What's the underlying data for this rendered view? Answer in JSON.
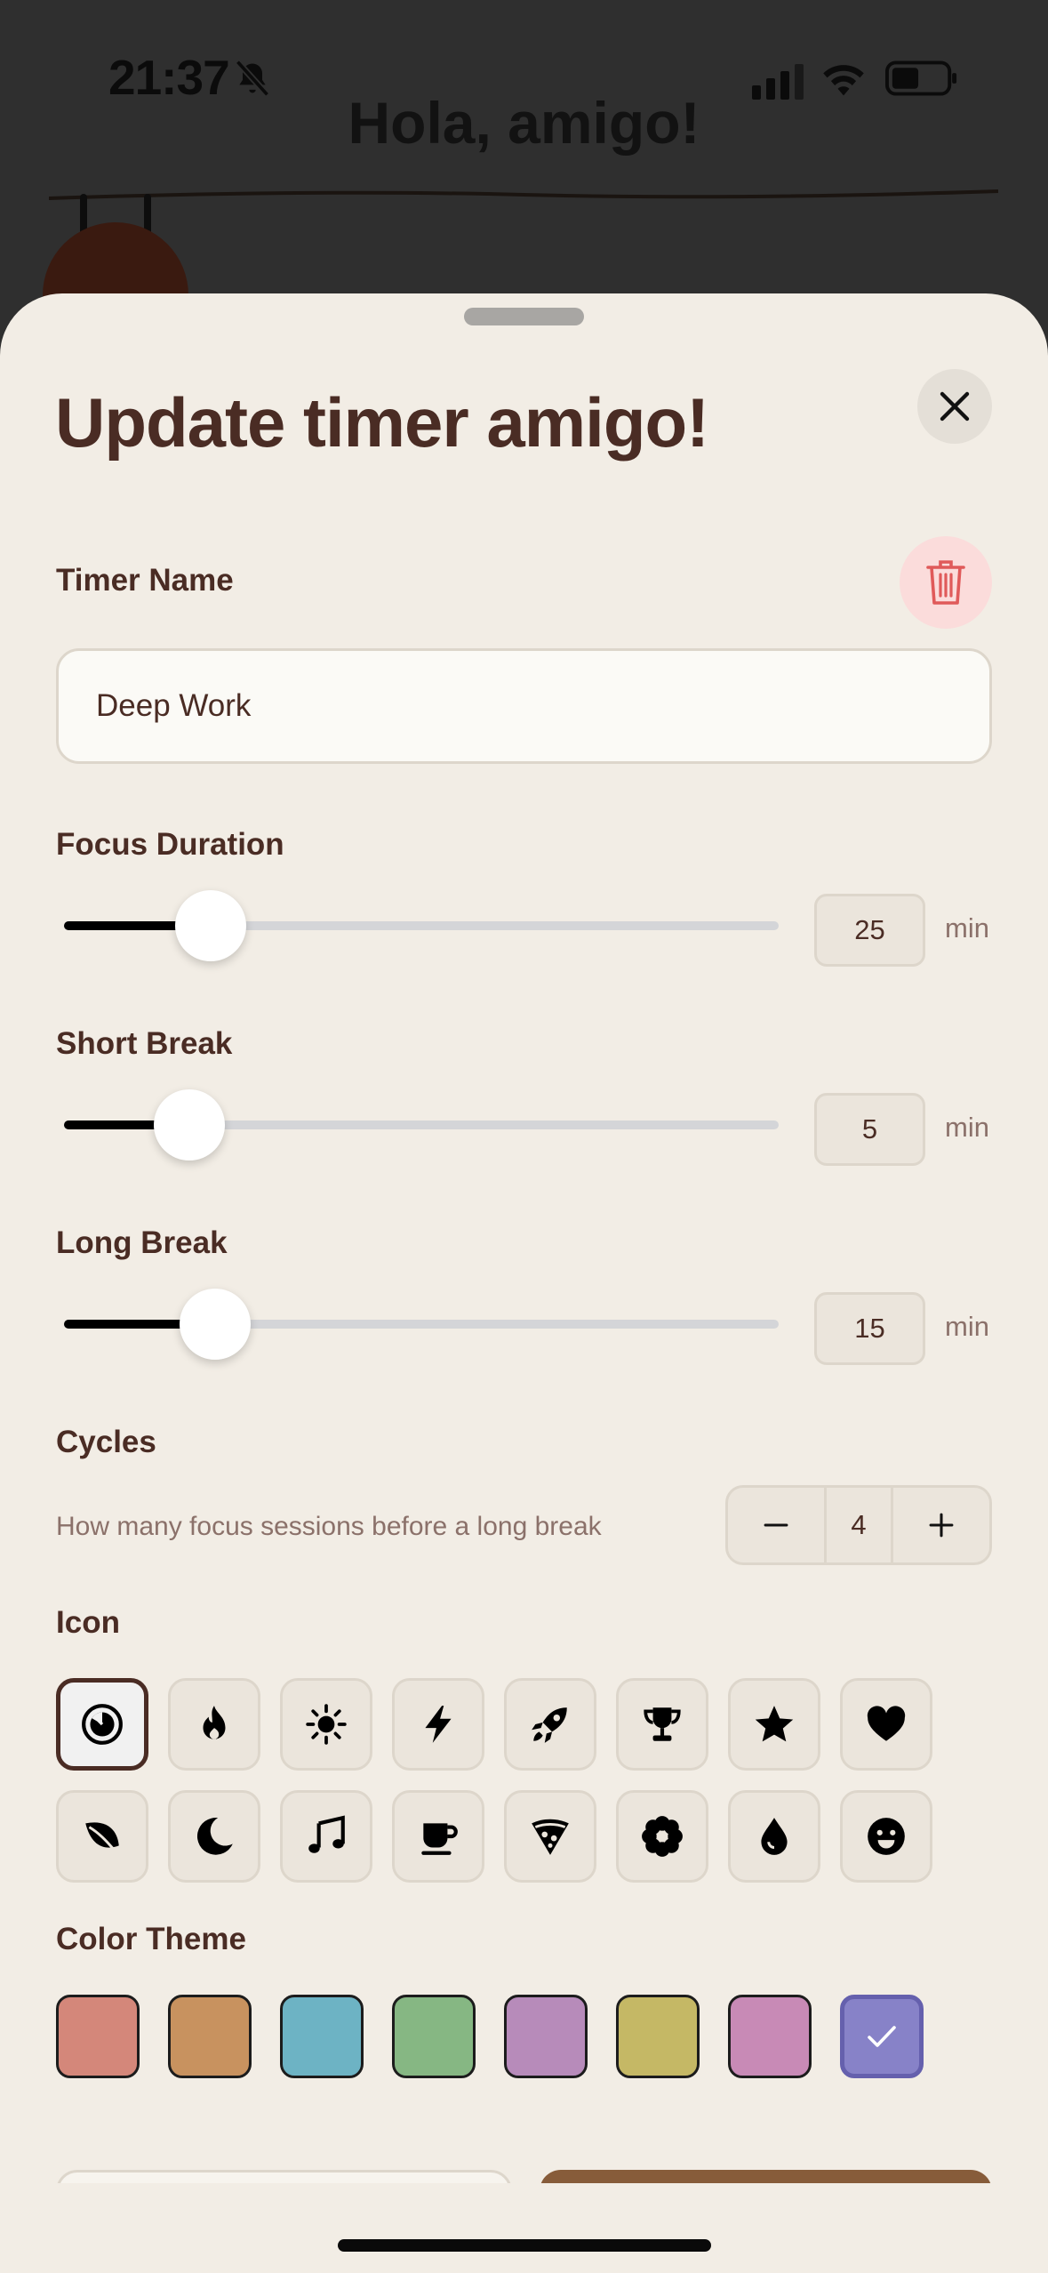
{
  "status_bar": {
    "time": "21:37"
  },
  "background": {
    "title": "Hola, amigo!"
  },
  "sheet": {
    "title": "Update timer amigo!",
    "timer_name": {
      "label": "Timer Name",
      "value": "Deep Work"
    },
    "focus": {
      "label": "Focus Duration",
      "value": "25",
      "unit": "min",
      "fraction": 0.205
    },
    "short_break": {
      "label": "Short Break",
      "value": "5",
      "unit": "min",
      "fraction": 0.175
    },
    "long_break": {
      "label": "Long Break",
      "value": "15",
      "unit": "min",
      "fraction": 0.212
    },
    "cycles": {
      "label": "Cycles",
      "description": "How many focus sessions before a long break",
      "value": "4"
    },
    "icon_section": {
      "label": "Icon",
      "selected": "timer-icon",
      "row1": [
        "timer-icon",
        "flame-icon",
        "sun-icon",
        "bolt-icon",
        "rocket-icon",
        "trophy-icon",
        "star-icon",
        "heart-icon"
      ],
      "row2": [
        "leaf-icon",
        "moon-icon",
        "music-note-icon",
        "coffee-cup-icon",
        "pizza-icon",
        "flower-icon",
        "drop-icon",
        "smiley-icon"
      ]
    },
    "color_section": {
      "label": "Color Theme",
      "colors": [
        "#d4877a",
        "#c8925f",
        "#6db3c4",
        "#86b783",
        "#b78bba",
        "#c5b865",
        "#c88ab6",
        "#8782c8"
      ],
      "selected_index": 7
    }
  },
  "theme": {
    "brown": "#4a2c24",
    "sheet_bg": "#f2ede5",
    "danger": "#e05a5a"
  }
}
